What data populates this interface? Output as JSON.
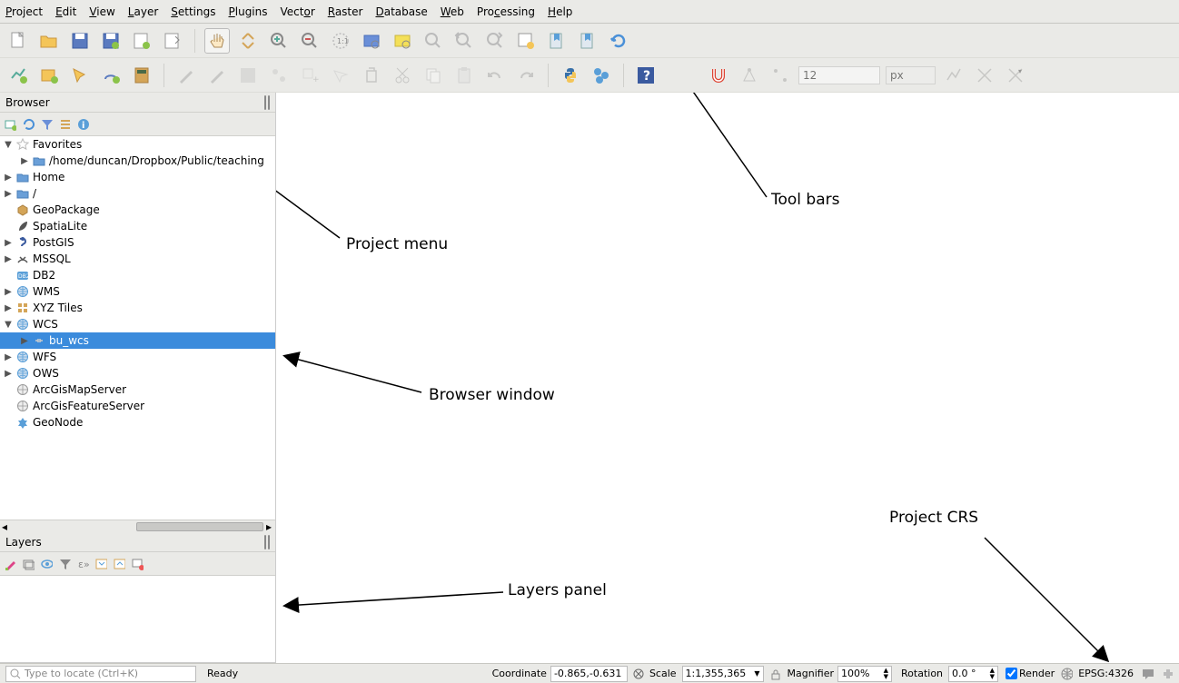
{
  "menubar": {
    "items": [
      "Project",
      "Edit",
      "View",
      "Layer",
      "Settings",
      "Plugins",
      "Vector",
      "Raster",
      "Database",
      "Web",
      "Processing",
      "Help"
    ]
  },
  "toolbar2": {
    "value": "12",
    "unit": "px"
  },
  "browser": {
    "title": "Browser",
    "tree": [
      {
        "label": "Favorites",
        "depth": 0,
        "arrow": "▼",
        "sel": false,
        "icon": "star"
      },
      {
        "label": "/home/duncan/Dropbox/Public/teaching",
        "depth": 1,
        "arrow": "▶",
        "sel": false,
        "icon": "folder"
      },
      {
        "label": "Home",
        "depth": 0,
        "arrow": "▶",
        "sel": false,
        "icon": "folder"
      },
      {
        "label": "/",
        "depth": 0,
        "arrow": "▶",
        "sel": false,
        "icon": "folder"
      },
      {
        "label": "GeoPackage",
        "depth": 0,
        "arrow": "",
        "sel": false,
        "icon": "geopkg"
      },
      {
        "label": "SpatiaLite",
        "depth": 0,
        "arrow": "",
        "sel": false,
        "icon": "feather"
      },
      {
        "label": "PostGIS",
        "depth": 0,
        "arrow": "▶",
        "sel": false,
        "icon": "postgis"
      },
      {
        "label": "MSSQL",
        "depth": 0,
        "arrow": "▶",
        "sel": false,
        "icon": "mssql"
      },
      {
        "label": "DB2",
        "depth": 0,
        "arrow": "",
        "sel": false,
        "icon": "db2"
      },
      {
        "label": "WMS",
        "depth": 0,
        "arrow": "▶",
        "sel": false,
        "icon": "globe"
      },
      {
        "label": "XYZ Tiles",
        "depth": 0,
        "arrow": "▶",
        "sel": false,
        "icon": "xyz"
      },
      {
        "label": "WCS",
        "depth": 0,
        "arrow": "▼",
        "sel": false,
        "icon": "globe"
      },
      {
        "label": "bu_wcs",
        "depth": 1,
        "arrow": "▶",
        "sel": true,
        "icon": "conn"
      },
      {
        "label": "WFS",
        "depth": 0,
        "arrow": "▶",
        "sel": false,
        "icon": "globe"
      },
      {
        "label": "OWS",
        "depth": 0,
        "arrow": "▶",
        "sel": false,
        "icon": "globe"
      },
      {
        "label": "ArcGisMapServer",
        "depth": 0,
        "arrow": "",
        "sel": false,
        "icon": "globe-g"
      },
      {
        "label": "ArcGisFeatureServer",
        "depth": 0,
        "arrow": "",
        "sel": false,
        "icon": "globe-g"
      },
      {
        "label": "GeoNode",
        "depth": 0,
        "arrow": "",
        "sel": false,
        "icon": "geonode"
      }
    ]
  },
  "layers": {
    "title": "Layers"
  },
  "status": {
    "locator_placeholder": "Type to locate (Ctrl+K)",
    "ready": "Ready",
    "coord_label": "Coordinate",
    "coord_value": "-0.865,-0.631",
    "scale_label": "Scale",
    "scale_value": "1:1,355,365",
    "mag_label": "Magnifier",
    "mag_value": "100%",
    "rot_label": "Rotation",
    "rot_value": "0.0 °",
    "render_label": "Render",
    "crs_value": "EPSG:4326"
  },
  "annotations": {
    "project_menu": "Project menu",
    "tool_bars": "Tool bars",
    "browser_window": "Browser window",
    "layers_panel": "Layers panel",
    "project_crs": "Project CRS"
  }
}
